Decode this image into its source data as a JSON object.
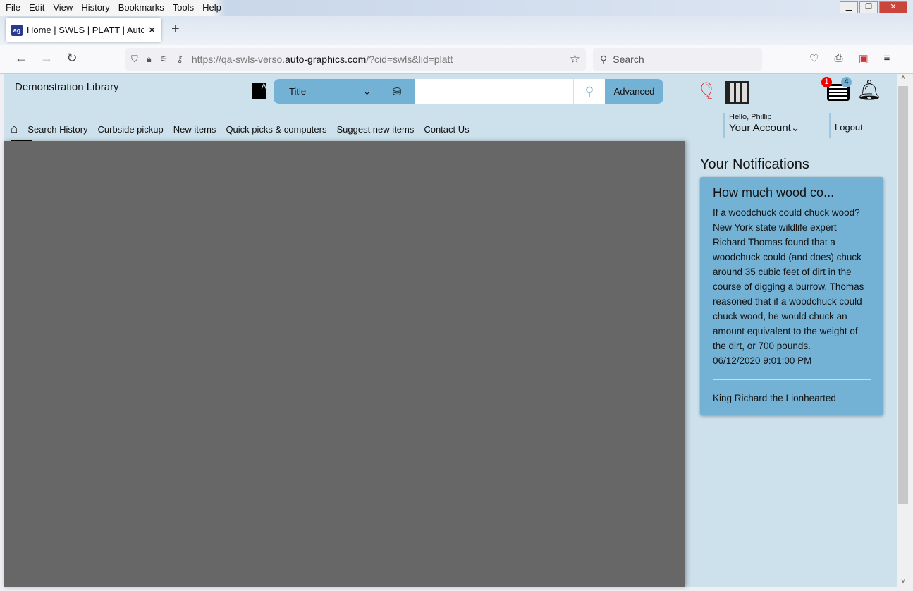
{
  "browser": {
    "menu": [
      "File",
      "Edit",
      "View",
      "History",
      "Bookmarks",
      "Tools",
      "Help"
    ],
    "tab_title": "Home | SWLS | PLATT | Auto-Graphics",
    "url_prefix": "https://qa-swls-verso.",
    "url_domain": "auto-graphics.com",
    "url_suffix": "/?cid=swls&lid=platt",
    "search_placeholder": "Search"
  },
  "header": {
    "library_name": "Demonstration Library",
    "search_type": "Title",
    "search_value": "",
    "advanced_label": "Advanced",
    "list_badge": "1",
    "notif_badge": "4"
  },
  "nav": {
    "items": [
      "Search History",
      "Curbside pickup",
      "New items",
      "Quick picks & computers",
      "Suggest new items",
      "Contact Us"
    ],
    "greeting": "Hello, Phillip",
    "account_label": "Your Account",
    "logout_label": "Logout"
  },
  "notifications": {
    "heading": "Your Notifications",
    "items": [
      {
        "title": "How much wood co...",
        "body": "If a woodchuck could chuck wood? New York state wildlife expert Richard Thomas found that a woodchuck could (and does) chuck around 35 cubic feet of dirt in the course of digging a burrow. Thomas reasoned that if a woodchuck could chuck wood, he would chuck an amount equivalent to the weight of the dirt, or 700 pounds.",
        "date": "06/12/2020 9:01:00 PM",
        "sender": "King Richard the Lionhearted"
      }
    ]
  },
  "colors": {
    "accent": "#74b2d5",
    "page_bg": "#cde1ec",
    "overlay": "#666766"
  }
}
